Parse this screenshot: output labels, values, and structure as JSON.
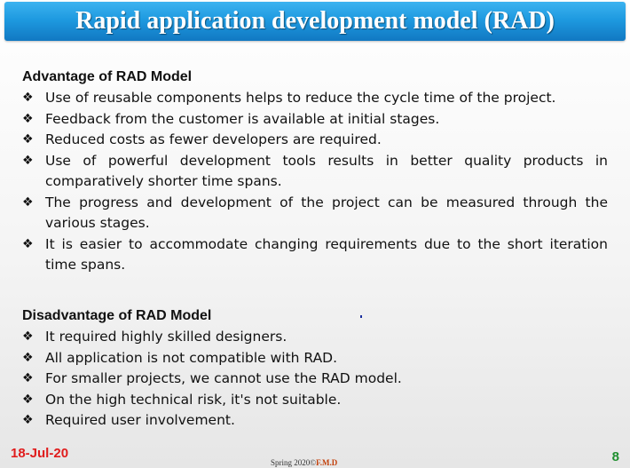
{
  "slide": {
    "title": "Rapid application development model (RAD)"
  },
  "advantages": {
    "heading": "Advantage of RAD Model",
    "bullet_icon": "diamond-bullet-icon",
    "items": [
      "Use of reusable components helps to reduce the cycle time of the project.",
      "Feedback from the customer is available at initial stages.",
      "Reduced costs as fewer developers are required.",
      "Use of powerful development tools results in better quality products in comparatively shorter time spans.",
      "The progress and development of the project can be measured through the various stages.",
      "It is easier to accommodate changing requirements due to the short iteration time spans."
    ]
  },
  "disadvantages": {
    "heading": "Disadvantage of RAD Model",
    "items": [
      "It required highly skilled designers.",
      "All application is not compatible with RAD.",
      "For smaller projects, we cannot use the RAD model.",
      "On the high technical risk, it's not suitable.",
      "Required user involvement."
    ]
  },
  "footer": {
    "date": "18-Jul-20",
    "center_text": "Spring 2020©",
    "center_initials": "F.M.D",
    "page_number": "8"
  },
  "colors": {
    "title_bar": "#1e9ae0",
    "title_text": "#ffffff",
    "date": "#e01c1c",
    "page_number": "#1f8f2f"
  }
}
